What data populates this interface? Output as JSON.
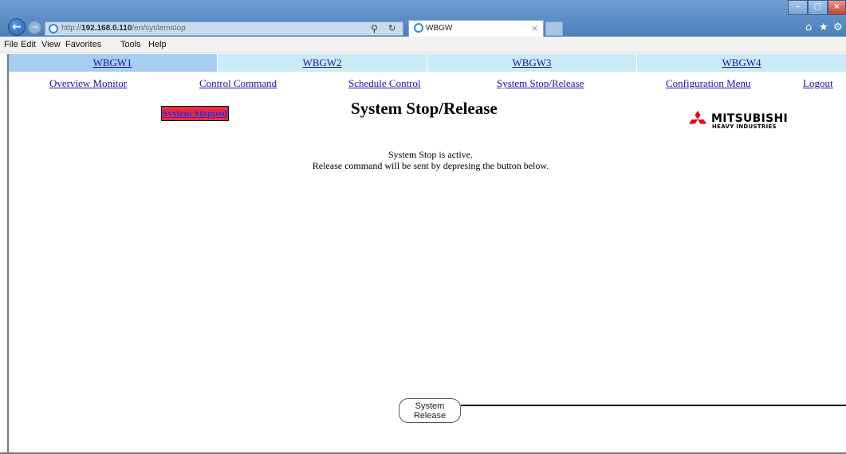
{
  "browser": {
    "url_prefix": "http://",
    "url_host": "192.168.0.110",
    "url_path": "/en/systemstop",
    "tab_title": "WBGW",
    "menu": [
      "File",
      "Edit",
      "View",
      "Favorites",
      "Tools",
      "Help"
    ]
  },
  "gateways": [
    {
      "label": "WBGW1",
      "bg": "#a6cdf2"
    },
    {
      "label": "WBGW2",
      "bg": "#c9ecf8"
    },
    {
      "label": "WBGW3",
      "bg": "#c9ecf8"
    },
    {
      "label": "WBGW4",
      "bg": "#c9ecf8"
    }
  ],
  "nav": [
    {
      "label": "Overview Monitor"
    },
    {
      "label": "Control Command"
    },
    {
      "label": "Schedule Control"
    },
    {
      "label": "System Stop/Release"
    },
    {
      "label": "Configuration Menu"
    },
    {
      "label": "Logout"
    }
  ],
  "status_badge": "System Stopped",
  "page_title": "System Stop/Release",
  "logo": {
    "name": "MITSUBISHI",
    "sub": "HEAVY INDUSTRIES"
  },
  "messages": {
    "line1": "System Stop is active.",
    "line2": "Release command will be sent by depresing the button below."
  },
  "release_button": {
    "line1": "System",
    "line2": "Release"
  },
  "colors": {
    "accent_red": "#ee2a3a",
    "link": "#1a0dab"
  }
}
